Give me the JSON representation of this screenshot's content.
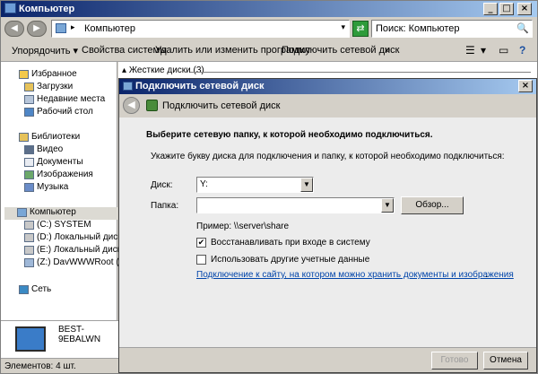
{
  "window": {
    "title": "Компьютер",
    "buttons": {
      "minimize": "_",
      "maximize": "□",
      "close": "×"
    }
  },
  "address_bar": {
    "path": "Компьютер",
    "separator": "▸",
    "dropdown_arrow": "▾",
    "back_icon": "back-arrow-icon",
    "forward_icon": "forward-arrow-icon",
    "back_glyph": "◀",
    "forward_glyph": "▶",
    "go_glyph": "⇄"
  },
  "search": {
    "text": "Поиск: Компьютер",
    "icon": "🔍"
  },
  "toolbar": {
    "items": [
      "Упорядочить ▾",
      "Свойства системы",
      "Удалить или изменить программу",
      "Подключить сетевой диск",
      "»"
    ],
    "view_icon": "☰",
    "view_arrow": "▾",
    "preview_icon": "▭",
    "help_icon": "?"
  },
  "nav": {
    "items": [
      {
        "label": "Избранное",
        "level": 0
      },
      {
        "label": "Загрузки",
        "level": 1
      },
      {
        "label": "Недавние места",
        "level": 1
      },
      {
        "label": "Рабочий стол",
        "level": 1
      },
      {
        "label": "Библиотеки",
        "level": 0
      },
      {
        "label": "Видео",
        "level": 1
      },
      {
        "label": "Документы",
        "level": 1
      },
      {
        "label": "Изображения",
        "level": 1
      },
      {
        "label": "Музыка",
        "level": 1
      },
      {
        "label": "Компьютер",
        "level": 0,
        "selected": true
      },
      {
        "label": "(C:) SYSTEM",
        "level": 1
      },
      {
        "label": "(D:) Локальный диск",
        "level": 1
      },
      {
        "label": "(E:) Локальный диск",
        "level": 1
      },
      {
        "label": "(Z:) DavWWWRoot (\\\\",
        "level": 1
      },
      {
        "label": "Сеть",
        "level": 0
      }
    ]
  },
  "main": {
    "group_header": "Жесткие диски (3)",
    "collapse_glyph": "▴"
  },
  "preview": {
    "name": "BEST-9EBALWN"
  },
  "status": {
    "items_count": "Элементов: 4 шт."
  },
  "dialog": {
    "title": "Подключить сетевой диск",
    "close": "×",
    "header": "Подключить сетевой диск",
    "back_glyph": "◀",
    "heading": "Выберите сетевую папку, к которой необходимо подключиться.",
    "instruction": "Укажите букву диска для подключения и папку, к которой необходимо подключиться:",
    "drive_label": "Диск:",
    "drive_value": "Y:",
    "folder_label": "Папка:",
    "folder_value": "",
    "browse_button": "Обзор...",
    "example": "Пример: \\\\server\\share",
    "reconnect_label": "Восстанавливать при входе в систему",
    "reconnect_checked": true,
    "other_creds_label": "Использовать другие учетные данные",
    "other_creds_checked": false,
    "link": "Подключение к сайту, на котором можно хранить документы и изображения",
    "link_suffix": ".",
    "finish_button": "Готово",
    "cancel_button": "Отмена",
    "check_glyph": "✔",
    "arrow_glyph": "▼"
  }
}
